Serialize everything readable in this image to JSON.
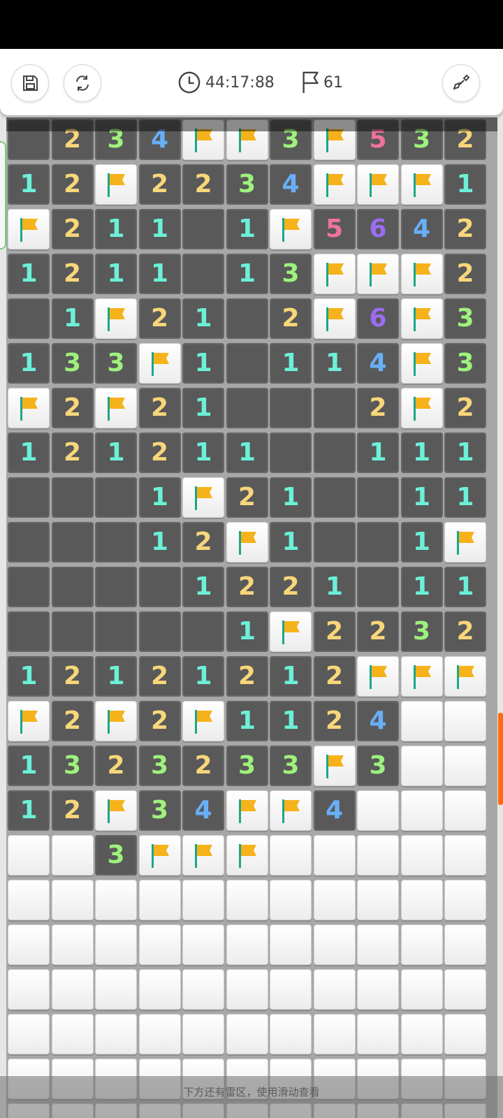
{
  "toolbar": {
    "save_icon": "save-icon",
    "refresh_icon": "refresh-icon",
    "timer_icon": "clock-icon",
    "timer": "44:17:88",
    "flag_icon": "flag-icon",
    "flags": "61",
    "tool_icon": "shovel-icon"
  },
  "colors": {
    "1": "#6cf0d8",
    "2": "#f8d67a",
    "3": "#9ef27c",
    "4": "#69aff7",
    "5": "#f0739b",
    "6": "#9c6cf3",
    "open_cell": "#595959",
    "hidden_cell": "#f4f4f4",
    "flag": "#f5b21b",
    "scroll_indicator": "#ff6a14"
  },
  "board": {
    "cols": 11,
    "rows": [
      "_234FF3F532",
      "12F2234FFF1",
      "F211_1F5642",
      "1211_13FFF2",
      "_1F21_2F6F3",
      "133F1_114F3",
      "F2F21___2F2",
      "121211__111",
      "___1F21__11",
      "___12F1__1F",
      "____1221_11",
      "_____1F2232",
      "12121212FFF",
      "F2F2F1124HH",
      "1323233F3HH",
      "12F34FF4HHH",
      "HH3FFFHHHHH",
      "HHHHHHHHHHH",
      "HHHHHHHHHHH",
      "HHHHHHHHHHH",
      "HHHHHHHHHHH",
      "HHHHHHHHHHH",
      "HHHHHHHHHHH"
    ]
  },
  "hint": "下方还有雷区，使用滑动查看"
}
